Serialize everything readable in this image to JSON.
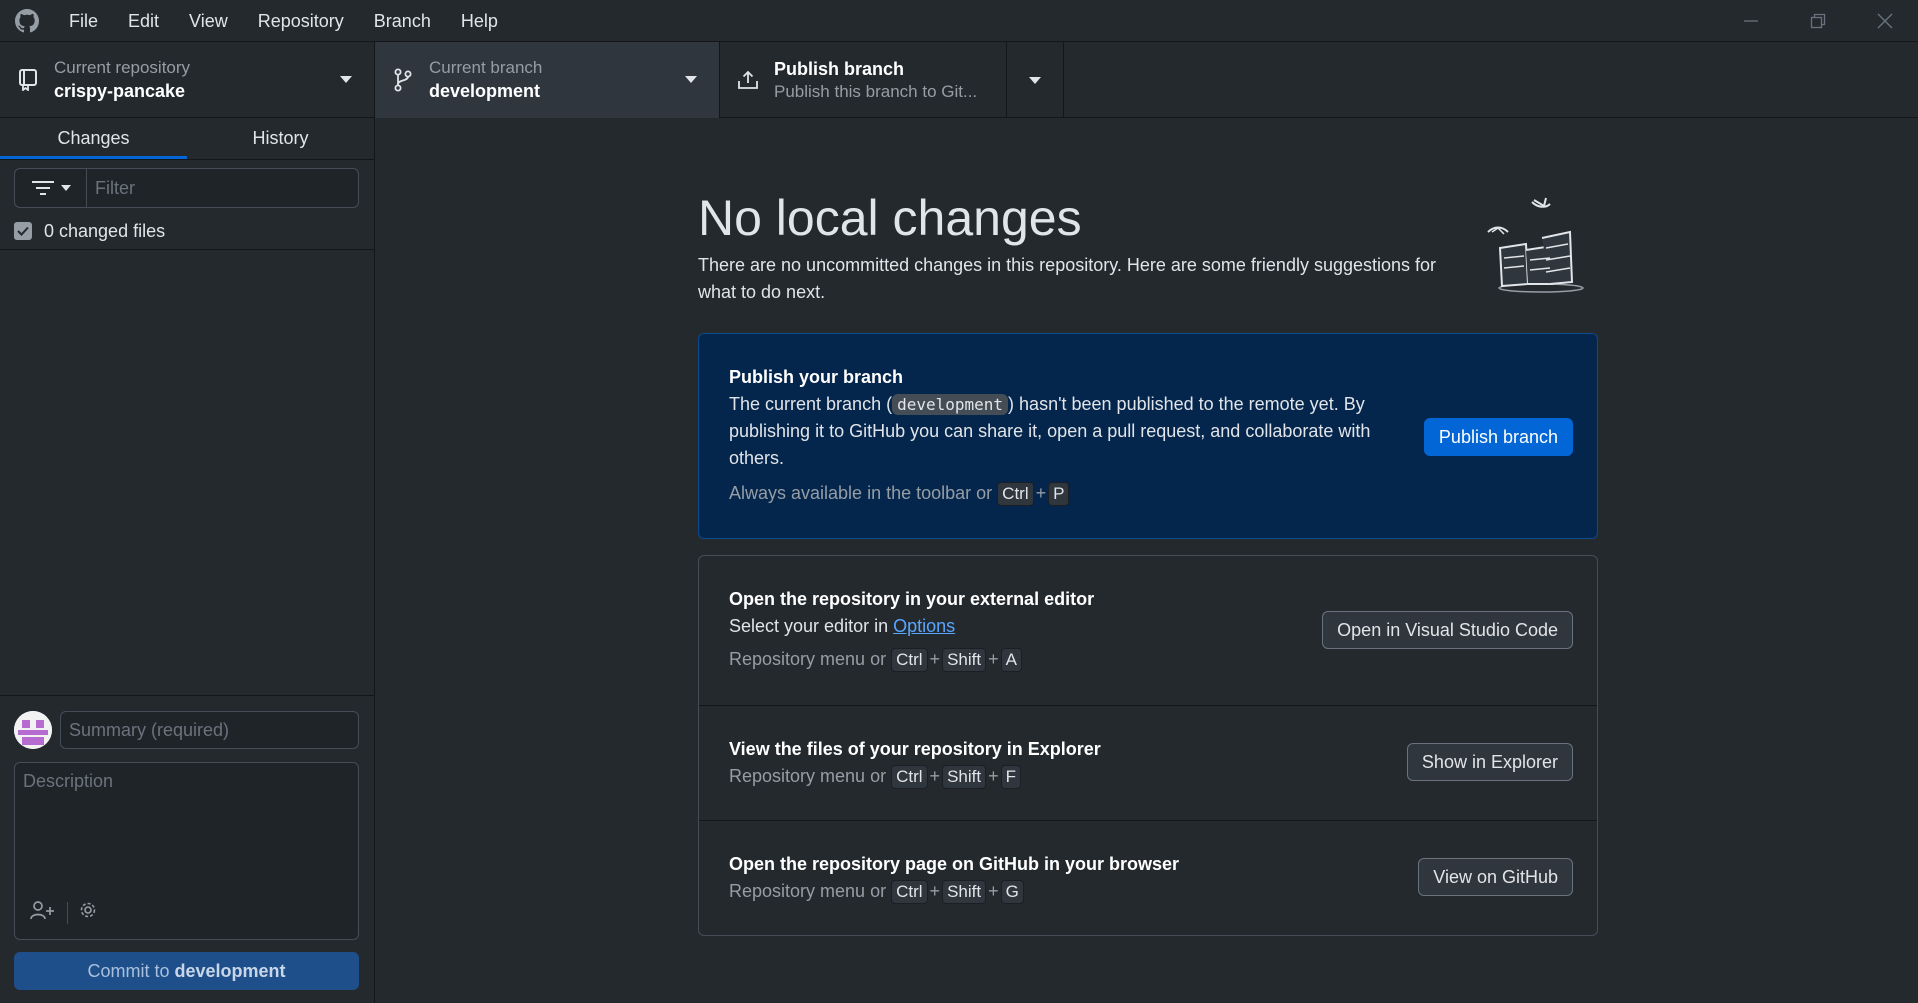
{
  "menu": [
    "File",
    "Edit",
    "View",
    "Repository",
    "Branch",
    "Help"
  ],
  "toolbar": {
    "repo_label": "Current repository",
    "repo_value": "crispy-pancake",
    "branch_label": "Current branch",
    "branch_value": "development",
    "publish_title": "Publish branch",
    "publish_sub": "Publish this branch to Git..."
  },
  "sidebar": {
    "tabs": [
      "Changes",
      "History"
    ],
    "filter_placeholder": "Filter",
    "changed_files": "0 changed files",
    "summary_placeholder": "Summary (required)",
    "description_placeholder": "Description",
    "commit_prefix": "Commit to ",
    "commit_branch": "development"
  },
  "main": {
    "title": "No local changes",
    "intro": "There are no uncommitted changes in this repository. Here are some friendly suggestions for what to do next.",
    "publish_card": {
      "title": "Publish your branch",
      "text_a": "The current branch (",
      "branch_code": "development",
      "text_b": ") hasn't been published to the remote yet. By publishing it to GitHub you can share it, open a pull request, and collaborate with others.",
      "hint": "Always available in the toolbar or",
      "keys": [
        "Ctrl",
        "P"
      ],
      "button": "Publish branch"
    },
    "editor_card": {
      "title": "Open the repository in your external editor",
      "text": "Select your editor in ",
      "link": "Options",
      "hint": "Repository menu or",
      "keys": [
        "Ctrl",
        "Shift",
        "A"
      ],
      "button": "Open in Visual Studio Code"
    },
    "explorer_card": {
      "title": "View the files of your repository in Explorer",
      "hint": "Repository menu or",
      "keys": [
        "Ctrl",
        "Shift",
        "F"
      ],
      "button": "Show in Explorer"
    },
    "github_card": {
      "title": "Open the repository page on GitHub in your browser",
      "hint": "Repository menu or",
      "keys": [
        "Ctrl",
        "Shift",
        "G"
      ],
      "button": "View on GitHub"
    }
  },
  "colors": {
    "background": "#24292e",
    "accent": "#0366d6",
    "publish_card_bg": "#05264c",
    "link": "#58a6ff"
  }
}
